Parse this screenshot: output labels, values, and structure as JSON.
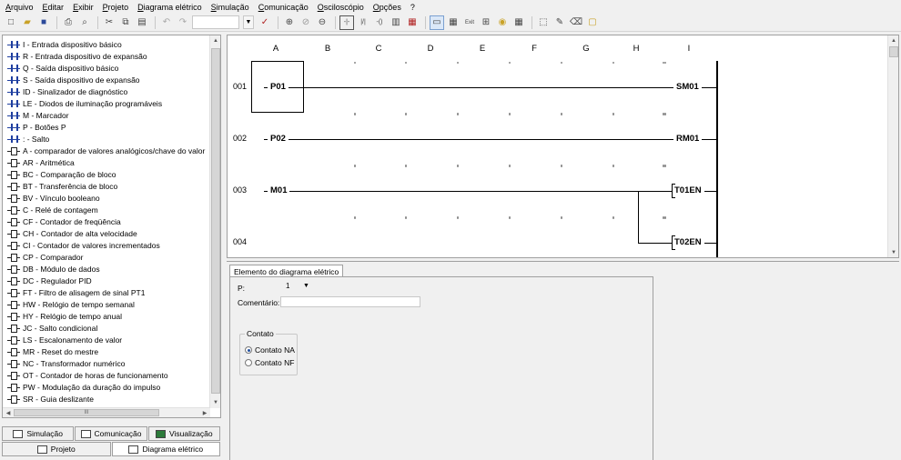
{
  "menu": [
    "Arquivo",
    "Editar",
    "Exibir",
    "Projeto",
    "Diagrama elétrico",
    "Simulação",
    "Comunicação",
    "Osciloscópio",
    "Opções",
    "?"
  ],
  "toolbar": {
    "icons": [
      "new-file-icon",
      "open-icon",
      "save-icon",
      "print-icon",
      "print-preview-icon",
      "cut-icon",
      "copy-icon",
      "paste-icon",
      "undo-icon",
      "redo-icon"
    ]
  },
  "instructions": [
    {
      "label": "I - Entrada dispositivo básico",
      "kind": "contact"
    },
    {
      "label": "R - Entrada dispositivo de expansão",
      "kind": "contact"
    },
    {
      "label": "Q - Saída dispositivo básico",
      "kind": "contact"
    },
    {
      "label": "S - Saída dispositivo de expansão",
      "kind": "contact"
    },
    {
      "label": "ID - Sinalizador de diagnóstico",
      "kind": "contact"
    },
    {
      "label": "LE - Diodos de iluminação programáveis",
      "kind": "contact"
    },
    {
      "label": "M - Marcador",
      "kind": "contact"
    },
    {
      "label": "P - Botões P",
      "kind": "contact"
    },
    {
      "label": ": - Salto",
      "kind": "contact"
    },
    {
      "label": "A - comparador de valores analógicos/chave do valor",
      "kind": "block"
    },
    {
      "label": "AR - Aritmética",
      "kind": "block"
    },
    {
      "label": "BC - Comparação de bloco",
      "kind": "block"
    },
    {
      "label": "BT - Transferência de bloco",
      "kind": "block"
    },
    {
      "label": "BV - Vínculo booleano",
      "kind": "block"
    },
    {
      "label": "C - Relé de contagem",
      "kind": "block"
    },
    {
      "label": "CF - Contador de freqüência",
      "kind": "block"
    },
    {
      "label": "CH - Contador de alta velocidade",
      "kind": "block"
    },
    {
      "label": "CI - Contador de valores incrementados",
      "kind": "block"
    },
    {
      "label": "CP - Comparador",
      "kind": "block"
    },
    {
      "label": "DB - Módulo de dados",
      "kind": "block"
    },
    {
      "label": "DC - Regulador PID",
      "kind": "block"
    },
    {
      "label": "FT - Filtro de alisagem de sinal PT1",
      "kind": "block"
    },
    {
      "label": "HW - Relógio de tempo semanal",
      "kind": "block"
    },
    {
      "label": "HY - Relógio de tempo anual",
      "kind": "block"
    },
    {
      "label": "JC - Salto condicional",
      "kind": "block"
    },
    {
      "label": "LS - Escalonamento de valor",
      "kind": "block"
    },
    {
      "label": "MR - Reset do mestre",
      "kind": "block"
    },
    {
      "label": "NC - Transformador numérico",
      "kind": "block"
    },
    {
      "label": "OT - Contador de horas de funcionamento",
      "kind": "block"
    },
    {
      "label": "PW - Modulação da duração do impulso",
      "kind": "block"
    },
    {
      "label": "SR - Guia deslizante",
      "kind": "block"
    }
  ],
  "hscroll_label": "III",
  "tabs_top": [
    {
      "label": "Simulação",
      "icon": "simulation-icon"
    },
    {
      "label": "Comunicação",
      "icon": "communication-icon"
    },
    {
      "label": "Visualização",
      "icon": "visualization-icon"
    }
  ],
  "tabs_bottom": [
    {
      "label": "Projeto",
      "icon": "project-icon"
    },
    {
      "label": "Diagrama elétrico",
      "icon": "wiring-diagram-icon"
    }
  ],
  "diagram": {
    "columns": [
      "A",
      "B",
      "C",
      "D",
      "E",
      "F",
      "G",
      "H",
      "I"
    ],
    "rungs": [
      {
        "num": "001",
        "contact": "P01",
        "coil": "SM01"
      },
      {
        "num": "002",
        "contact": "P02",
        "coil": "RM01"
      },
      {
        "num": "003",
        "contact": "M01",
        "coil": "T01EN"
      },
      {
        "num": "004",
        "contact": "",
        "coil": "T02EN"
      }
    ]
  },
  "props": {
    "tab": "Elemento do diagrama elétrico",
    "p_label": "P:",
    "p_value": "1",
    "comment_label": "Comentário:",
    "comment_value": "",
    "group_title": "Contato",
    "options": [
      {
        "label": "Contato NA",
        "checked": true
      },
      {
        "label": "Contato NF",
        "checked": false
      }
    ]
  }
}
